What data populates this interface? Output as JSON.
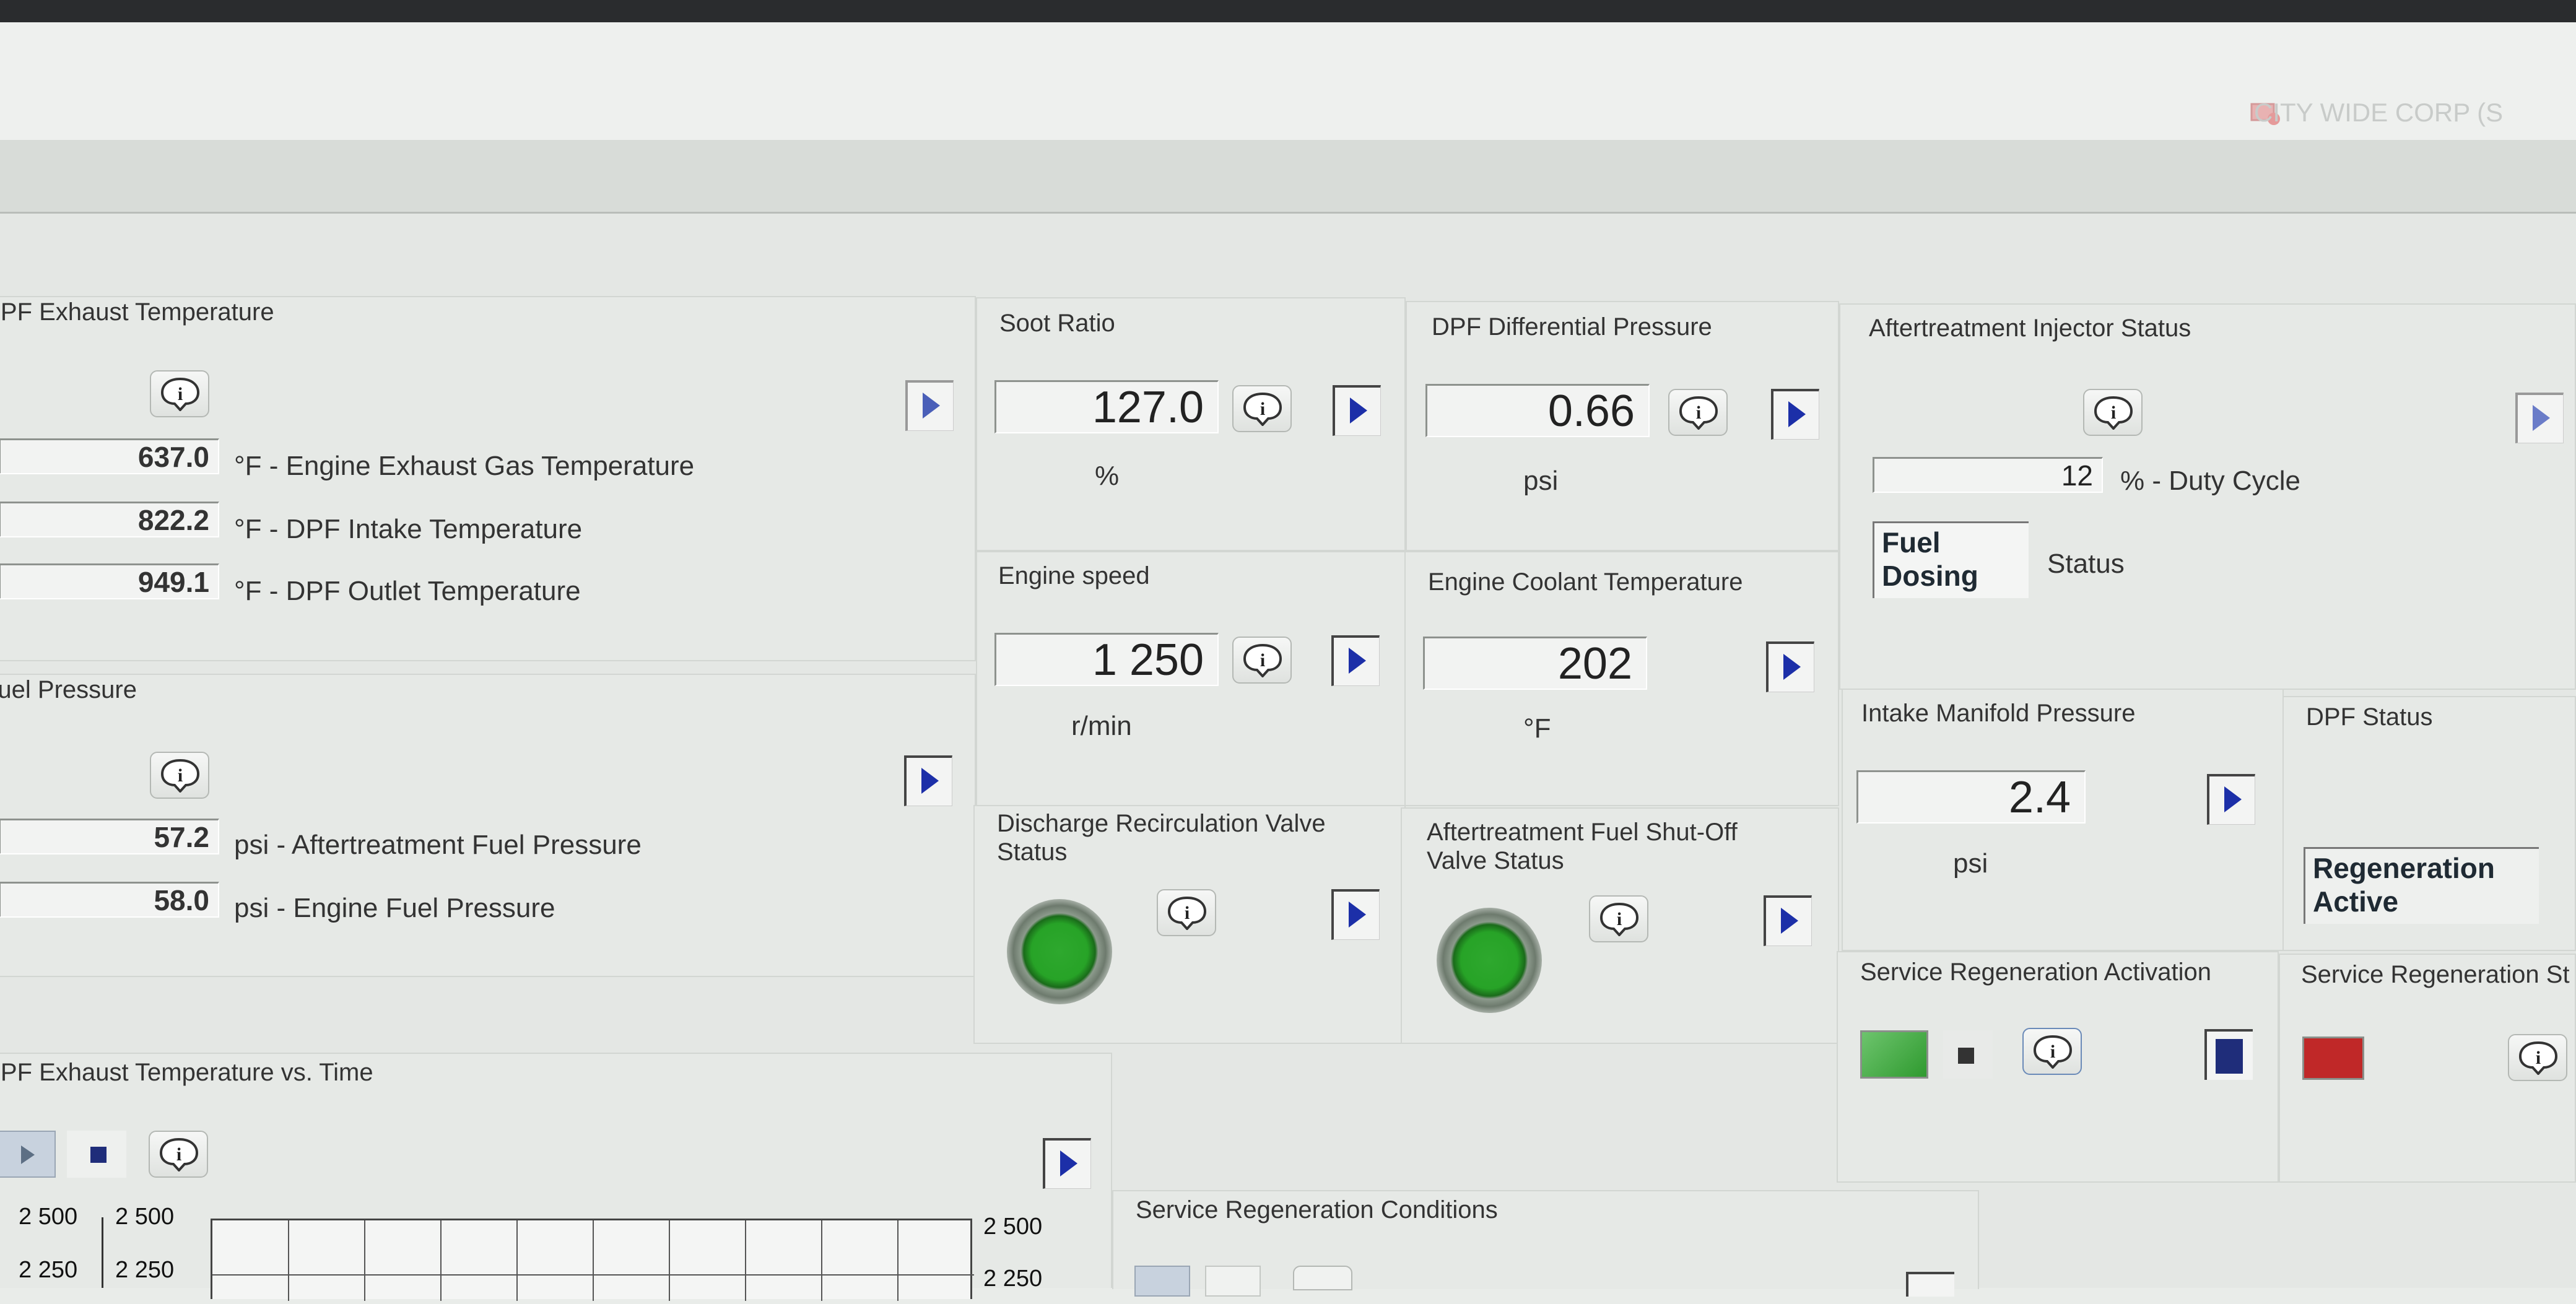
{
  "header": {
    "company": "CITY WIDE CORP (S"
  },
  "panels": {
    "exhaust_temp": {
      "title": "DPF Exhaust Temperature",
      "rows": [
        {
          "value": "637.0",
          "label": "°F - Engine Exhaust Gas Temperature"
        },
        {
          "value": "822.2",
          "label": "°F - DPF Intake Temperature"
        },
        {
          "value": "949.1",
          "label": "°F - DPF Outlet Temperature"
        }
      ]
    },
    "fuel_pressure": {
      "title": "Fuel Pressure",
      "rows": [
        {
          "value": "57.2",
          "label": "psi - Aftertreatment Fuel Pressure"
        },
        {
          "value": "58.0",
          "label": "psi - Engine Fuel Pressure"
        }
      ]
    },
    "soot_ratio": {
      "title": "Soot Ratio",
      "value": "127.0",
      "unit": "%"
    },
    "dpf_diff_pressure": {
      "title": "DPF Differential Pressure",
      "value": "0.66",
      "unit": "psi"
    },
    "engine_speed": {
      "title": "Engine speed",
      "value": "1 250",
      "unit": "r/min"
    },
    "coolant_temp": {
      "title": "Engine Coolant Temperature",
      "value": "202",
      "unit": "°F"
    },
    "discharge_valve": {
      "title_line1": "Discharge Recirculation Valve",
      "title_line2": "Status",
      "led_color": "#2ea82e"
    },
    "fuel_shutoff_valve": {
      "title_line1": "Aftertreatment Fuel Shut-Off",
      "title_line2": "Valve Status",
      "led_color": "#2ea82e"
    },
    "injector_status": {
      "title": "Aftertreatment Injector Status",
      "duty_value": "12",
      "duty_label": "% - Duty Cycle",
      "status_line1": "Fuel",
      "status_line2": "Dosing",
      "status_label": "Status"
    },
    "intake_manifold": {
      "title": "Intake Manifold Pressure",
      "value": "2.4",
      "unit": "psi"
    },
    "dpf_status": {
      "title": "DPF Status",
      "status_line1": "Regeneration",
      "status_line2": "Active"
    },
    "service_regen_activation": {
      "title": "Service Regeneration Activation",
      "indicator_color": "#3cab3c",
      "stop_color": "#1f2d7a"
    },
    "service_regen_status": {
      "title": "Service Regeneration St",
      "indicator_color": "#c02828"
    },
    "exhaust_temp_chart": {
      "title": "DPF Exhaust Temperature vs. Time",
      "ticks_left_a": [
        "2 500",
        "2 250"
      ],
      "ticks_left_b": [
        "2 500",
        "2 250"
      ],
      "ticks_right": [
        "2 500",
        "2 250"
      ]
    },
    "service_regen_conditions": {
      "title": "Service Regeneration Conditions"
    }
  },
  "colors": {
    "arrow": "#1c2fa8",
    "background": "#e6e9e6"
  }
}
